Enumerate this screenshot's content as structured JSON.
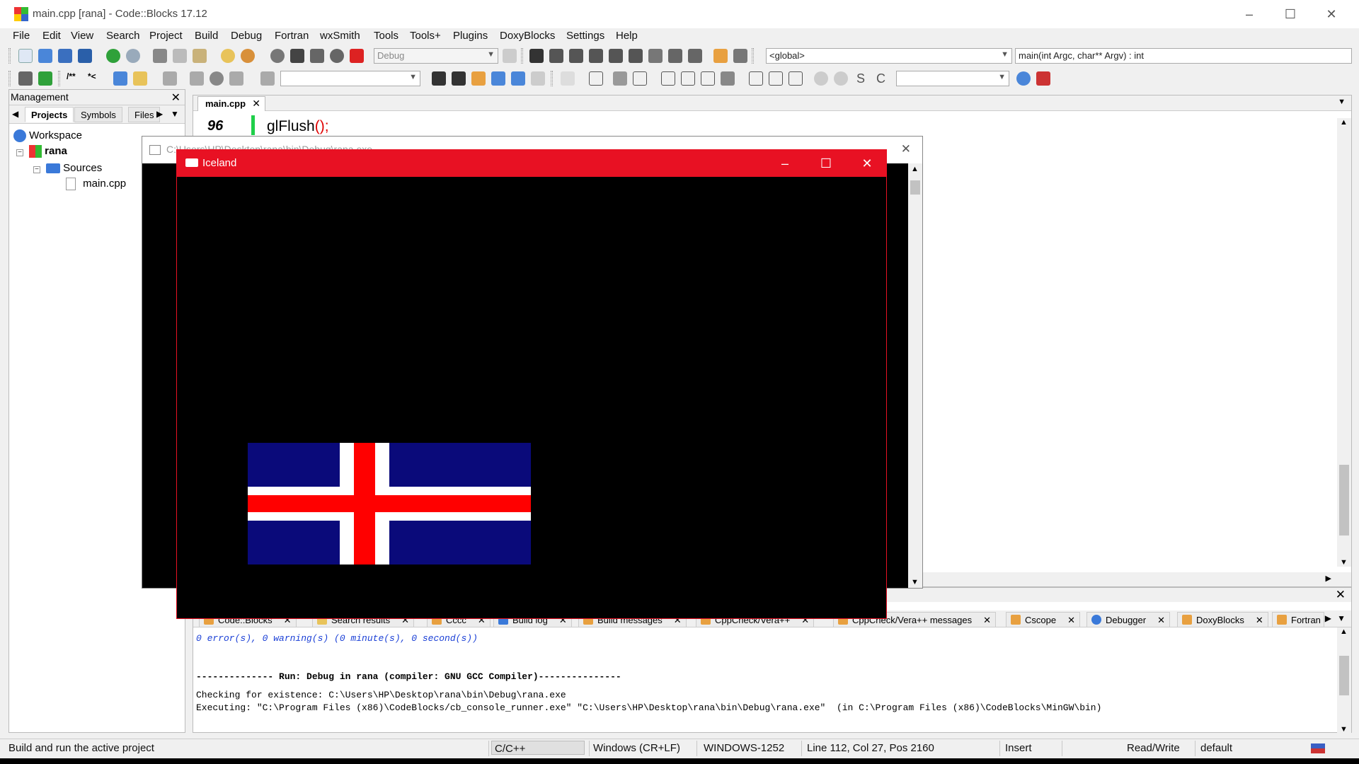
{
  "window": {
    "title": "main.cpp [rana] - Code::Blocks 17.12"
  },
  "menu": [
    "File",
    "Edit",
    "View",
    "Search",
    "Project",
    "Build",
    "Debug",
    "Fortran",
    "wxSmith",
    "Tools",
    "Tools+",
    "Plugins",
    "DoxyBlocks",
    "Settings",
    "Help"
  ],
  "toolbar": {
    "build_target": "Debug",
    "scope": "<global>",
    "function": "main(int Argc, char** Argv) : int"
  },
  "management": {
    "title": "Management",
    "tabs": [
      "Projects",
      "Symbols",
      "Files"
    ],
    "tree": {
      "workspace": "Workspace",
      "project": "rana",
      "folder": "Sources",
      "file": "main.cpp"
    }
  },
  "editor": {
    "tab": "main.cpp",
    "line_number": "96",
    "code_fn": "glFlush",
    "code_paren": "();"
  },
  "console_window": {
    "title": "C:\\Users\\HP\\Desktop\\rana\\bin\\Debug\\rana.exe"
  },
  "gl_window": {
    "title": "Iceland"
  },
  "logs": {
    "tabs": [
      "Code::Blocks",
      "Search results",
      "Cccc",
      "Build log",
      "Build messages",
      "CppCheck/Vera++",
      "CppCheck/Vera++ messages",
      "Cscope",
      "Debugger",
      "DoxyBlocks",
      "Fortran"
    ],
    "lines": {
      "summary": "0 error(s), 0 warning(s) (0 minute(s), 0 second(s))",
      "run": "-------------- Run: Debug in rana (compiler: GNU GCC Compiler)---------------",
      "check": "Checking for existence: C:\\Users\\HP\\Desktop\\rana\\bin\\Debug\\rana.exe",
      "exec": "Executing: \"C:\\Program Files (x86)\\CodeBlocks/cb_console_runner.exe\" \"C:\\Users\\HP\\Desktop\\rana\\bin\\Debug\\rana.exe\"  (in C:\\Program Files (x86)\\CodeBlocks\\MinGW\\bin)"
    }
  },
  "status": {
    "hint": "Build and run the active project",
    "language": "C/C++",
    "eol": "Windows (CR+LF)",
    "encoding": "WINDOWS-1252",
    "position": "Line 112, Col 27, Pos 2160",
    "mode": "Insert",
    "access": "Read/Write",
    "lexer": "default"
  },
  "colors": {
    "flag_blue": "#0a0a7a",
    "flag_red": "#ff0000",
    "flag_white": "#ffffff",
    "gl_titlebar": "#e81123"
  }
}
